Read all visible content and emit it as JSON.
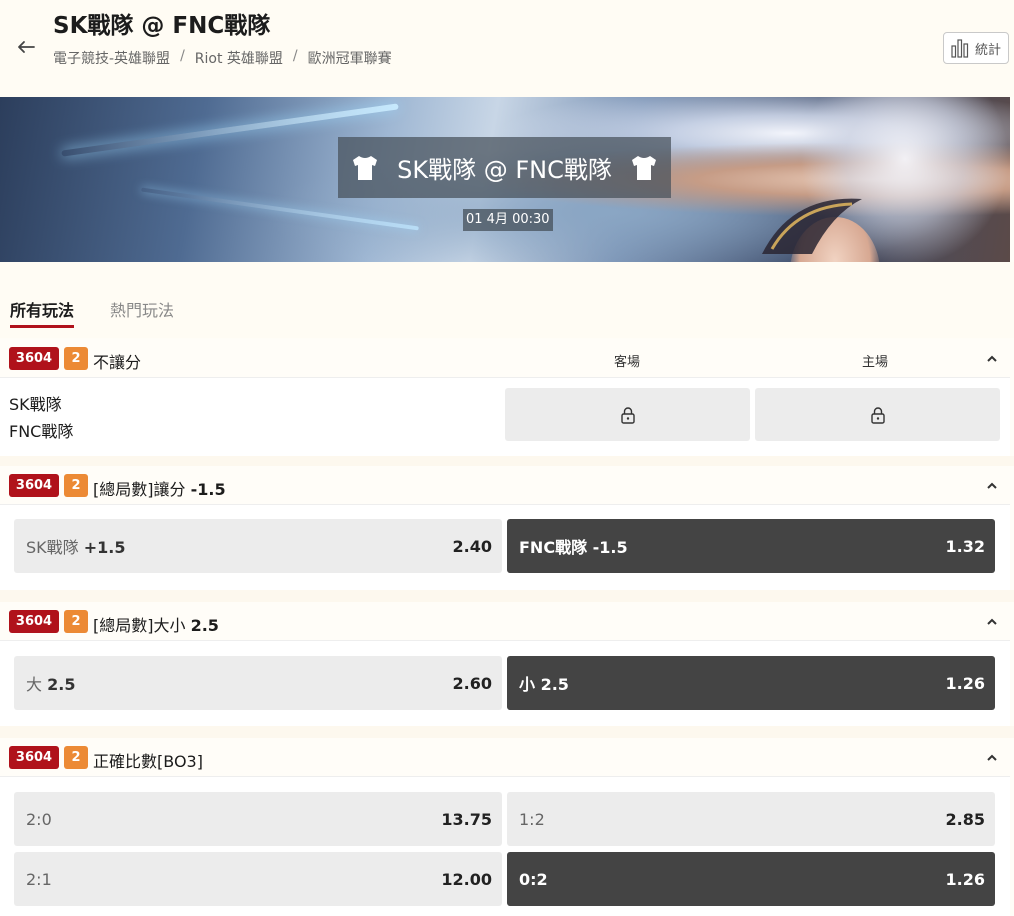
{
  "header": {
    "title": "SK戰隊 @ FNC戰隊",
    "breadcrumb": [
      "電子競技-英雄聯盟",
      "Riot 英雄聯盟",
      "歐洲冠軍聯賽"
    ],
    "stats_label": "統計"
  },
  "banner": {
    "match_title": "SK戰隊 @ FNC戰隊",
    "match_time": "01 4月 00:30"
  },
  "tabs": [
    {
      "label": "所有玩法",
      "active": true
    },
    {
      "label": "熱門玩法",
      "active": false
    }
  ],
  "colors": {
    "accent": "#b0121b",
    "badge_count": "#ec8a35",
    "selected_odd": "#444444"
  },
  "markets": [
    {
      "id": "3604",
      "count": "2",
      "title": "不讓分",
      "title_bold": "",
      "columns": [
        "客場",
        "主場"
      ],
      "teams": [
        "SK戰隊",
        "FNC戰隊"
      ],
      "locked": true,
      "lock_icon": "lock-icon"
    },
    {
      "id": "3604",
      "count": "2",
      "title": "[總局數]讓分",
      "title_bold": "-1.5",
      "options": [
        {
          "label": "SK戰隊",
          "line": "+1.5",
          "odds": "2.40",
          "selected": false
        },
        {
          "label": "FNC戰隊",
          "line": "-1.5",
          "odds": "1.32",
          "selected": true
        }
      ]
    },
    {
      "id": "3604",
      "count": "2",
      "title": "[總局數]大小",
      "title_bold": "2.5",
      "options": [
        {
          "label": "大",
          "line": "2.5",
          "odds": "2.60",
          "selected": false
        },
        {
          "label": "小",
          "line": "2.5",
          "odds": "1.26",
          "selected": true
        }
      ]
    },
    {
      "id": "3604",
      "count": "2",
      "title": "正確比數[BO3]",
      "title_bold": "",
      "options": [
        {
          "label": "2:0",
          "odds": "13.75",
          "selected": false
        },
        {
          "label": "1:2",
          "odds": "2.85",
          "selected": false
        },
        {
          "label": "2:1",
          "odds": "12.00",
          "selected": false
        },
        {
          "label": "0:2",
          "odds": "1.26",
          "selected": true
        }
      ]
    }
  ]
}
